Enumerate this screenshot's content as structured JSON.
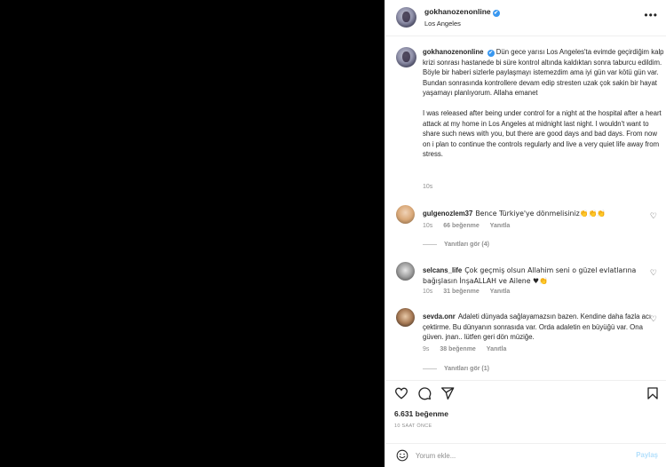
{
  "header": {
    "username": "gokhanozenonline",
    "verified_mark": "✔",
    "location": "Los Angeles"
  },
  "caption": {
    "username": "gokhanozenonline",
    "verified_mark": "✔",
    "text_tr": "Dün gece yarısı Los Angeles'ta evimde geçirdiğim kalp krizi sonrası hastanede bi süre kontrol altında kaldıktan sonra taburcu edildim. Böyle bir haberi sizlerle paylaşmayı istemezdim ama iyi gün var kötü gün var. Bundan sonrasında kontrollere devam edip stresten uzak çok sakin bir hayat yaşamayı planlıyorum. Allaha emanet",
    "text_en": "I was released after being under control for a night at the hospital after a heart attack at my home in Los Angeles at midnight last night. I wouldn't want to share such news with you, but there are good days and bad days. From now on i plan to continue the controls regularly and live a very quiet life away from stress.",
    "time": "10s"
  },
  "comments": [
    {
      "username": "gulgenozlem37",
      "text": "Bence Türkiye'ye dönmelisiniz👏👏👏",
      "time": "10s",
      "likes": "66 beğenme",
      "reply": "Yanıtla",
      "view_replies": "Yanıtları gör (4)"
    },
    {
      "username": "selcans_life",
      "text": "Çok geçmiş olsun Allahim seni o güzel evlatlarına bağışlasın İnşaALLAH ve Ailene ♥👏",
      "time": "10s",
      "likes": "31 beğenme",
      "reply": "Yanıtla"
    },
    {
      "username": "sevda.onr",
      "text": "Adaleti dünyada sağlayamazsın bazen. Kendine daha fazla acı çektirme. Bu dünyanın sonrasıda var. Orda adaletin en büyüğü var. Ona güven. jnan.. lütfen geri dön müziğe.",
      "time": "9s",
      "likes": "38 beğenme",
      "reply": "Yanıtla",
      "view_replies": "Yanıtları gör (1)"
    }
  ],
  "actions": {
    "likes": "6.631 beğenme",
    "time_ago": "10 SAAT ÖNCE"
  },
  "comment_bar": {
    "placeholder": "Yorum ekle...",
    "post_label": "Paylaş"
  },
  "icons": [
    "more-icon",
    "heart-icon",
    "comment-icon",
    "share-icon",
    "bookmark-icon",
    "smile-icon",
    "small-heart-icon",
    "verified-icon"
  ],
  "colors": {
    "verified": "#3897f0",
    "muted": "#8e8e8e",
    "post_disabled": "#b2dffc",
    "text": "#262626"
  }
}
